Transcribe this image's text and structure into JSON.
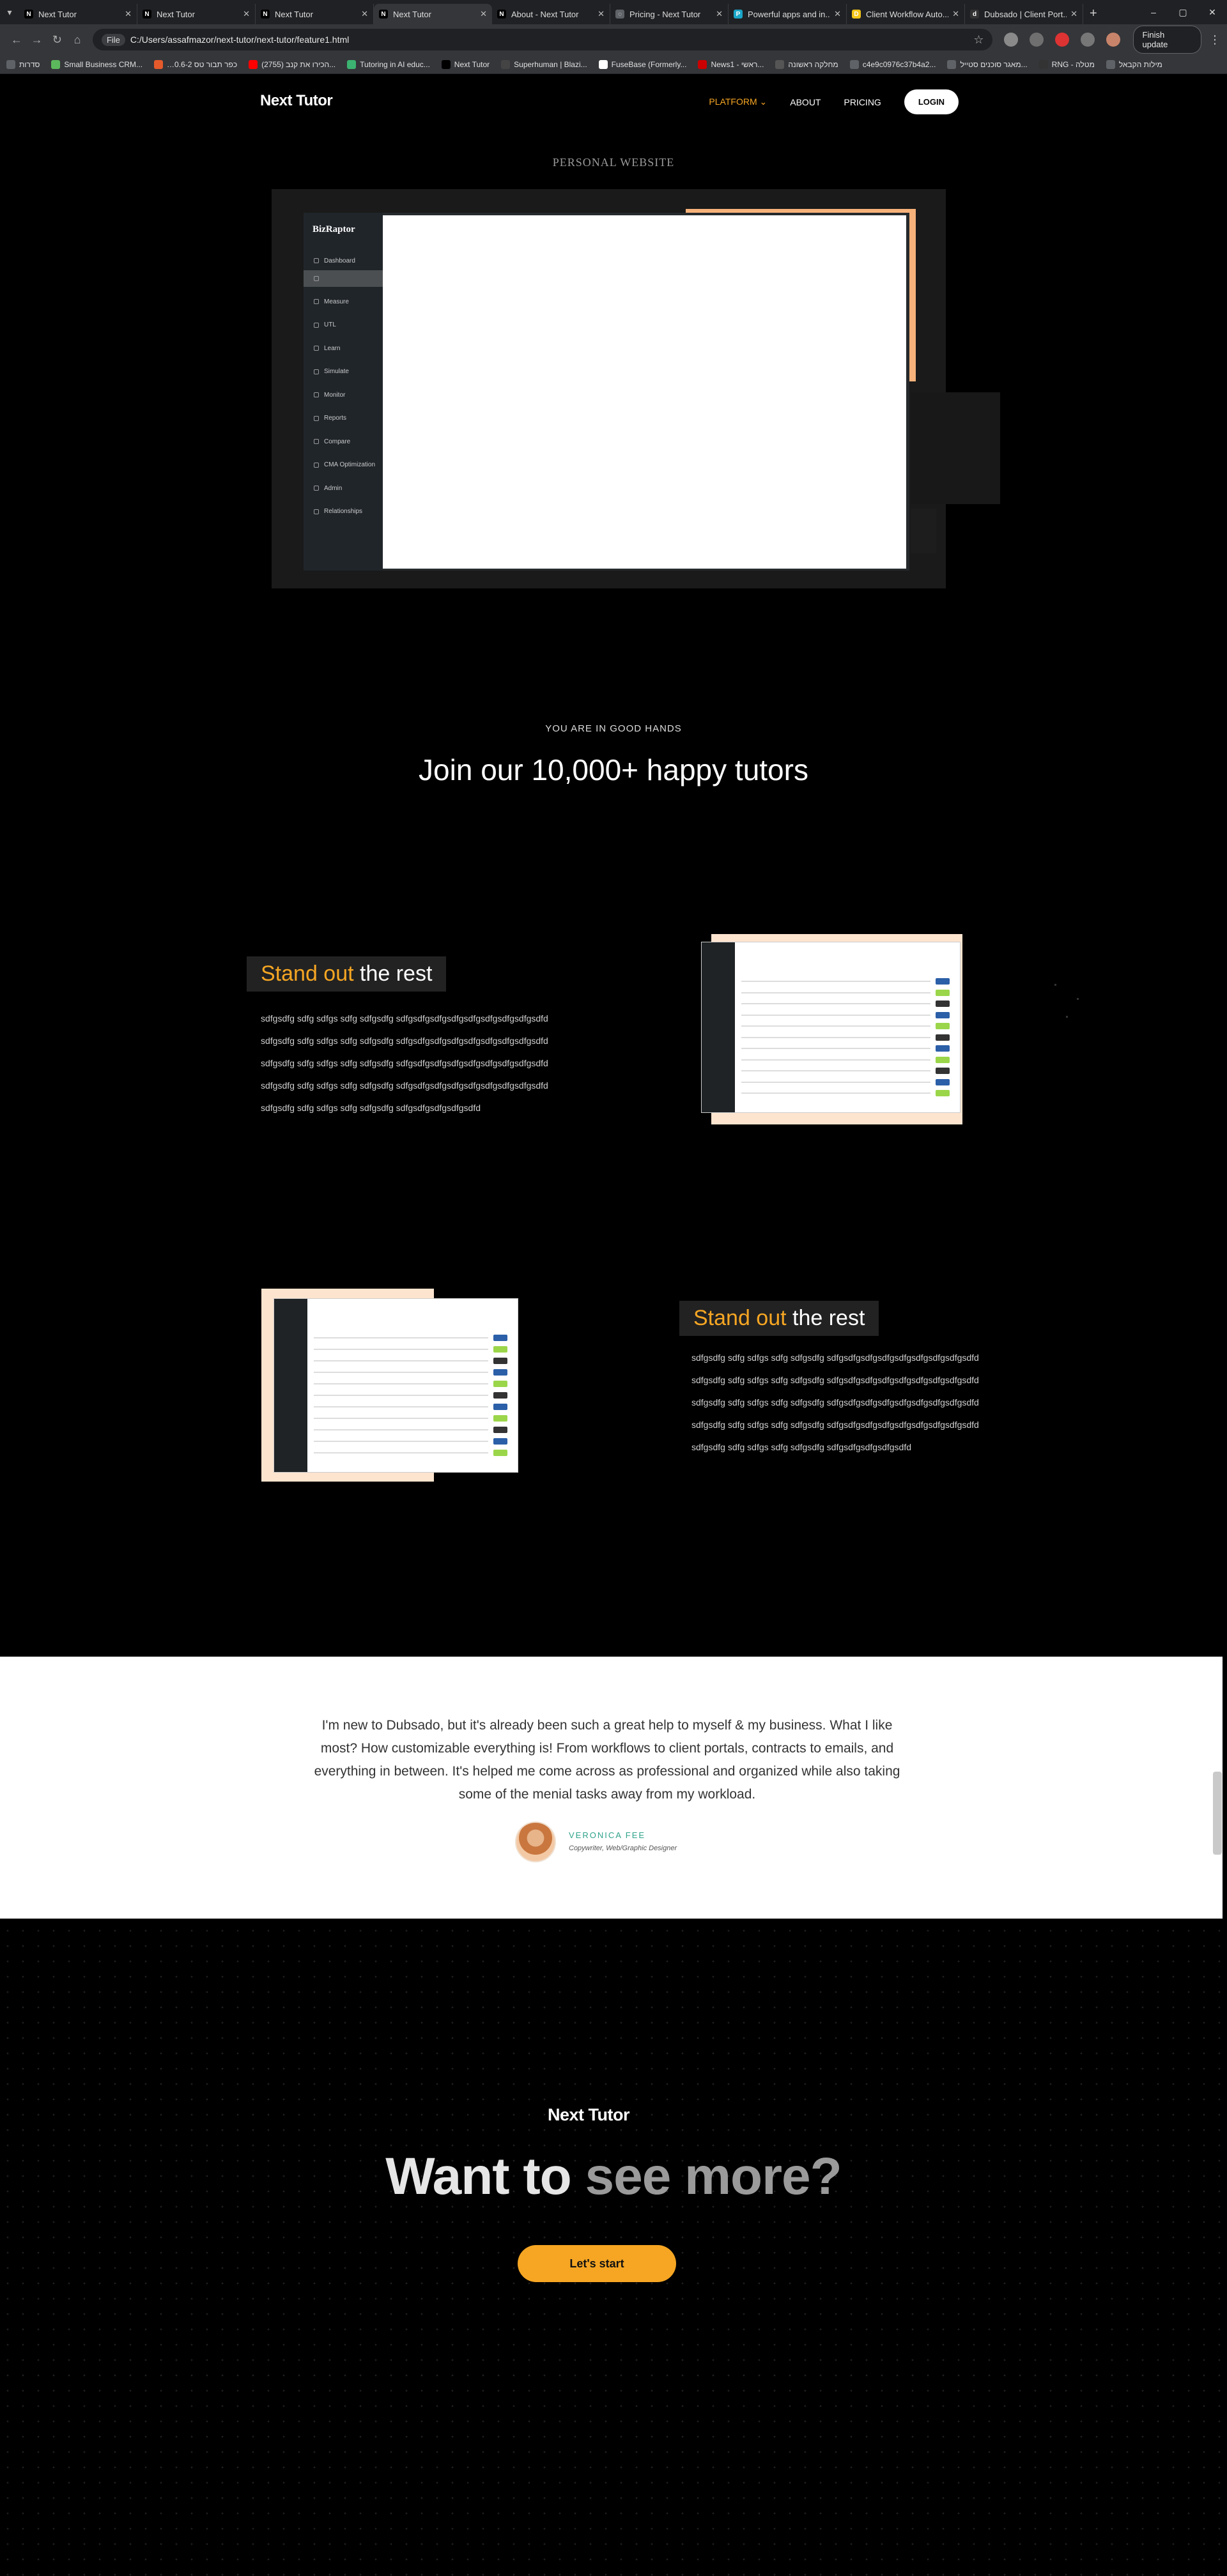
{
  "browser": {
    "tabs": [
      {
        "title": "Next Tutor",
        "fav": "N",
        "fav_color": "#000000"
      },
      {
        "title": "Next Tutor",
        "fav": "N",
        "fav_color": "#000000"
      },
      {
        "title": "Next Tutor",
        "fav": "N",
        "fav_color": "#000000"
      },
      {
        "title": "Next Tutor",
        "fav": "N",
        "fav_color": "#000000"
      },
      {
        "title": "About - Next Tutor",
        "fav": "N",
        "fav_color": "#000000"
      },
      {
        "title": "Pricing - Next Tutor",
        "fav": "◌",
        "fav_color": "#5f6368"
      },
      {
        "title": "Powerful apps and in...",
        "fav": "P",
        "fav_color": "#1aa6c8"
      },
      {
        "title": "Client Workflow Auto...",
        "fav": "D",
        "fav_color": "#f5c518"
      },
      {
        "title": "Dubsado | Client Port...",
        "fav": "d",
        "fav_color": "#333333"
      }
    ],
    "active_tab_index": 3,
    "url_chip": "File",
    "url": "C:/Users/assafmazor/next-tutor/next-tutor/feature1.html",
    "update_button": "Finish update",
    "bookmarks": [
      {
        "label": "סדרות",
        "color": "#5f6368"
      },
      {
        "label": "Small Business CRM...",
        "color": "#5cb85c"
      },
      {
        "label": "…0.6-2 כפר תבור טס",
        "color": "#e55a2b"
      },
      {
        "label": "(2755) הכירו את קנב...",
        "color": "#ff0000"
      },
      {
        "label": "Tutoring in AI educ...",
        "color": "#3cb371"
      },
      {
        "label": "Next Tutor",
        "color": "#000000"
      },
      {
        "label": "Superhuman | Blazi...",
        "color": "#444444"
      },
      {
        "label": "FuseBase (Formerly...",
        "color": "#ffffff"
      },
      {
        "label": "News1 - ראשי...",
        "color": "#cc0000"
      },
      {
        "label": "מחלקה ראשונה",
        "color": "#555555"
      },
      {
        "label": "c4e9c0976c37b4a2...",
        "color": "#5f6368"
      },
      {
        "label": "מאגר סוכנים סטייל...",
        "color": "#5f6368"
      },
      {
        "label": "RNG - מטלה",
        "color": "#333333"
      },
      {
        "label": "מילות הקבאל",
        "color": "#5f6368"
      }
    ]
  },
  "site": {
    "logo": "Next Tutor",
    "nav": {
      "platform": "PLATFORM",
      "about": "ABOUT",
      "pricing": "PRICING",
      "login": "LOGIN"
    },
    "hero": {
      "eyebrow": "PERSONAL WEBSITE",
      "app_logo": "BizRaptor",
      "app_menu": [
        "Dashboard",
        "Measure",
        "UTL",
        "Learn",
        "Simulate",
        "Monitor",
        "Reports",
        "Compare",
        "CMA Optimization",
        "Admin",
        "Relationships"
      ]
    },
    "social_proof": {
      "eyebrow": "YOU ARE IN GOOD HANDS",
      "title": "Join our 10,000+ happy tutors"
    },
    "features": [
      {
        "title_highlight": "Stand out",
        "title_rest": " the rest",
        "lines": [
          "sdfgsdfg sdfg sdfgs sdfg sdfgsdfg sdfgsdfgsdfgsdfgsdfgsdfgsdfgsdfgsdfd",
          "sdfgsdfg sdfg sdfgs sdfg sdfgsdfg sdfgsdfgsdfgsdfgsdfgsdfgsdfgsdfgsdfd",
          "sdfgsdfg sdfg sdfgs sdfg sdfgsdfg sdfgsdfgsdfgsdfgsdfgsdfgsdfgsdfgsdfd",
          "sdfgsdfg sdfg sdfgs sdfg sdfgsdfg sdfgsdfgsdfgsdfgsdfgsdfgsdfgsdfgsdfd",
          "sdfgsdfg sdfg sdfgs sdfg sdfgsdfg sdfgsdfgsdfgsdfgsdfd"
        ]
      },
      {
        "title_highlight": "Stand out",
        "title_rest": " the rest",
        "lines": [
          "sdfgsdfg sdfg sdfgs sdfg sdfgsdfg sdfgsdfgsdfgsdfgsdfgsdfgsdfgsdfgsdfd",
          "sdfgsdfg sdfg sdfgs sdfg sdfgsdfg sdfgsdfgsdfgsdfgsdfgsdfgsdfgsdfgsdfd",
          "sdfgsdfg sdfg sdfgs sdfg sdfgsdfg sdfgsdfgsdfgsdfgsdfgsdfgsdfgsdfgsdfd",
          "sdfgsdfg sdfg sdfgs sdfg sdfgsdfg sdfgsdfgsdfgsdfgsdfgsdfgsdfgsdfgsdfd",
          "sdfgsdfg sdfg sdfgs sdfg sdfgsdfg sdfgsdfgsdfgsdfgsdfd"
        ]
      }
    ],
    "testimonial": {
      "quote": "I'm new to Dubsado, but it's already been such a great help to myself & my business. What I like most? How customizable everything is! From workflows to client portals, contracts to emails, and everything in between. It's helped me come across as professional and organized while also taking some of the menial tasks away from my workload.",
      "name": "VERONICA FEE",
      "role": "Copywriter, Web/Graphic Designer"
    },
    "cta": {
      "logo": "Next Tutor",
      "title_a": "Want to ",
      "title_b": "see more?",
      "button": "Let's start"
    }
  },
  "colors": {
    "accent": "#f6a623",
    "page_bg": "#000000",
    "testimonial_bg": "#ffffff",
    "name_green": "#2ea38a"
  }
}
